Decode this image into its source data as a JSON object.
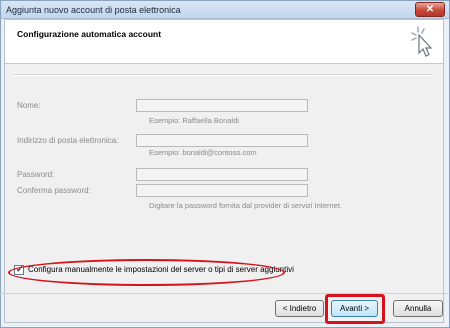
{
  "window": {
    "title": "Aggiunta nuovo account di posta elettronica",
    "close_symbol": "✕"
  },
  "header": {
    "title": "Configurazione automatica account",
    "icon": "wizard-cursor-icon"
  },
  "form": {
    "name_label": "Nome:",
    "name_value": "",
    "name_hint": "Esempio: Raffaella Bonaldi",
    "email_label": "Indirizzo di posta elettronica:",
    "email_value": "",
    "email_hint": "Esempio: bonaldi@contoso.com",
    "password_label": "Password:",
    "password_value": "",
    "confirm_label": "Conferma password:",
    "confirm_value": "",
    "password_hint": "Digitare la password fornita dal provider di servizi Internet."
  },
  "manual_config": {
    "checked": true,
    "check_symbol": "✓",
    "label": "Configura manualmente le impostazioni del server o tipi di server aggiuntivi"
  },
  "buttons": {
    "back": "< Indietro",
    "next": "Avanti >",
    "cancel": "Annulla"
  },
  "colors": {
    "highlight": "#d3141c",
    "title_bar": "#c3d6ee",
    "dialog_bg": "#f0f0f0"
  }
}
